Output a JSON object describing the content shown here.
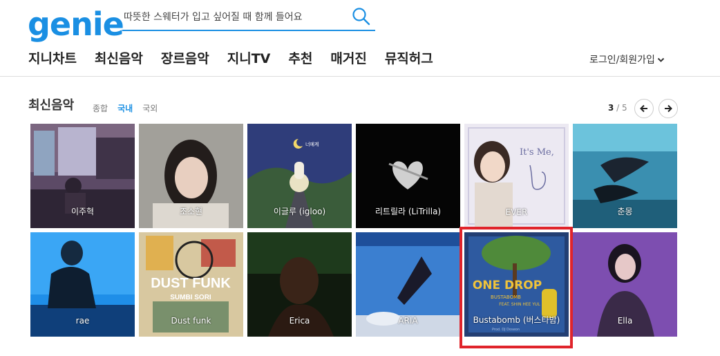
{
  "header": {
    "logo": "genie",
    "search_placeholder": "따뜻한 스웨터가 입고 싶어질 때 함께 들어요",
    "login": "로그인/회원가입"
  },
  "nav": [
    "지니차트",
    "최신음악",
    "장르음악",
    "지니TV",
    "추천",
    "매거진",
    "뮤직허그"
  ],
  "section": {
    "title": "최신음악",
    "subtabs": [
      "종합",
      "국내",
      "국외"
    ],
    "active_subtab": "국내",
    "page_current": "3",
    "page_sep": " / ",
    "page_total": "5"
  },
  "albums": [
    {
      "artist": "이주혁"
    },
    {
      "artist": "조소현"
    },
    {
      "artist": "이글루 (igloo)"
    },
    {
      "artist": "리트릴라 (LiTrilla)"
    },
    {
      "artist": "EVER"
    },
    {
      "artist": "춘몽"
    },
    {
      "artist": "rae"
    },
    {
      "artist": "Dust funk"
    },
    {
      "artist": "Erica"
    },
    {
      "artist": "ARIA"
    },
    {
      "artist": "Bustabomb (버스타밤)"
    },
    {
      "artist": "Ella"
    }
  ],
  "album_art_text": {
    "igloo_cover": "너에게",
    "ever_cover": "It's Me,",
    "dustfunk_cover_title": "DUST FUNK",
    "dustfunk_cover_sub": "SUMBI SORI",
    "bustabomb_cover_title": "ONE DROP",
    "bustabomb_cover_sub": "BUSTABOMB",
    "bustabomb_cover_feat": "FEAT. SHIN HEE YUL",
    "bustabomb_cover_prod": "Prod. DJ Doseon"
  },
  "colors": {
    "brand": "#1a8fe3",
    "highlight": "#e0242b"
  }
}
